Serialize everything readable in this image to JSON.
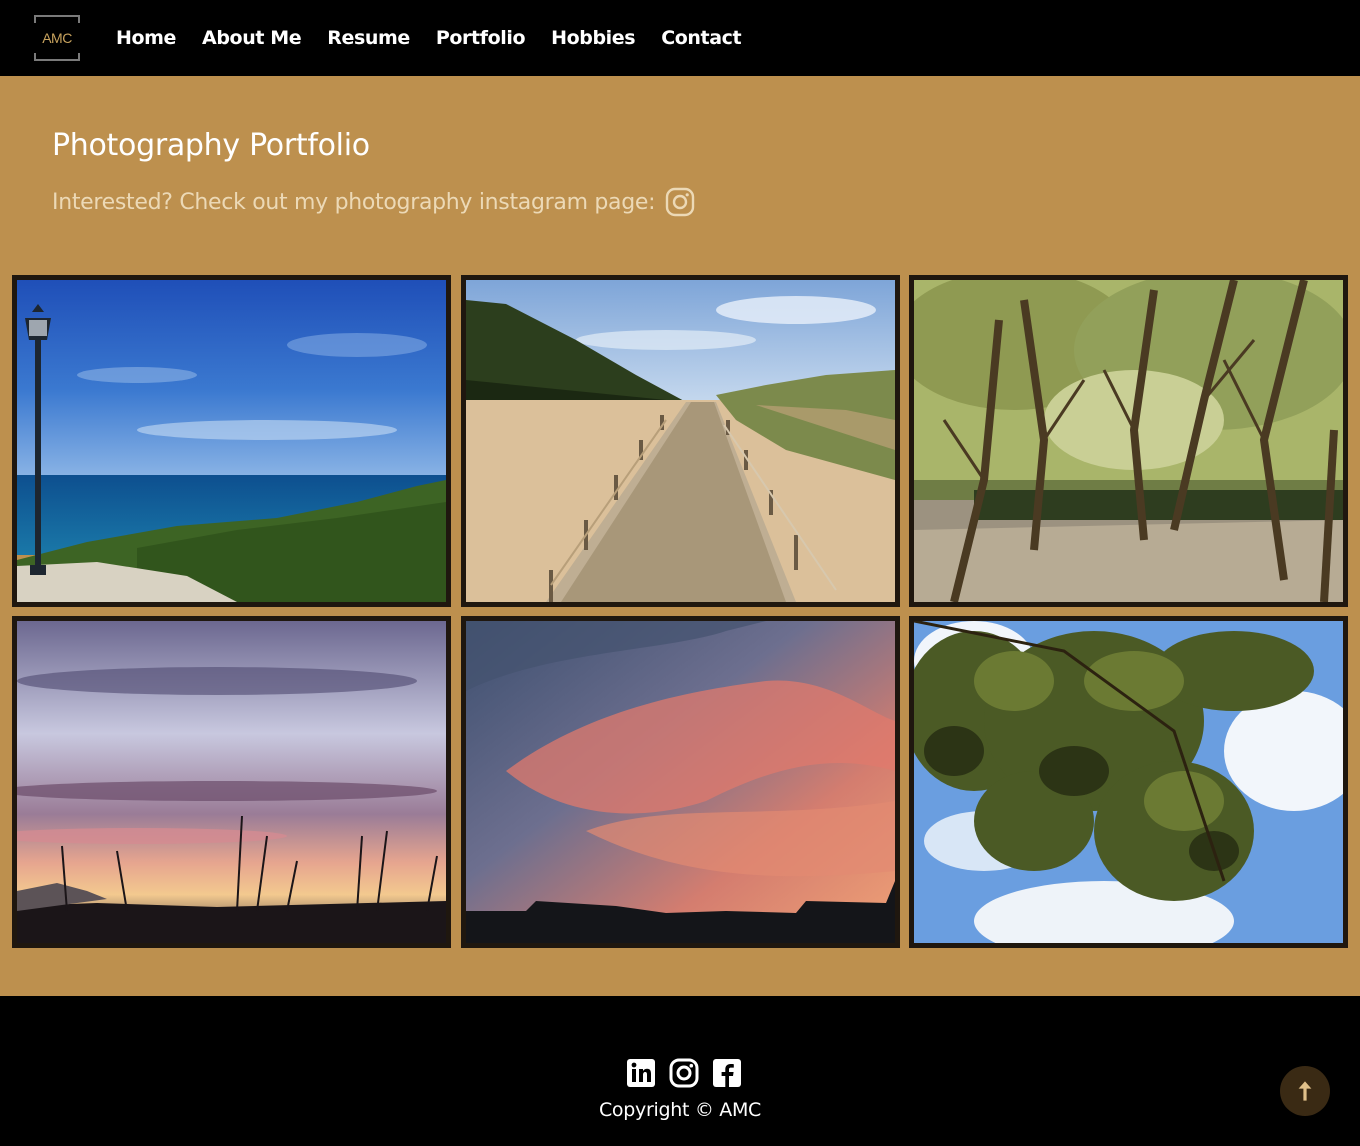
{
  "nav": {
    "logo_text": "AMC",
    "links": [
      {
        "label": "Home"
      },
      {
        "label": "About Me"
      },
      {
        "label": "Resume"
      },
      {
        "label": "Portfolio"
      },
      {
        "label": "Hobbies"
      },
      {
        "label": "Contact"
      }
    ]
  },
  "header": {
    "title": "Photography Portfolio",
    "subtitle": "Interested? Check out my photography instagram page:",
    "instagram_icon": "instagram-icon"
  },
  "gallery": {
    "photos": [
      {
        "subject": "sea-view-with-lamppost"
      },
      {
        "subject": "beach-boardwalk"
      },
      {
        "subject": "tree-lined-path"
      },
      {
        "subject": "sunset-with-grass"
      },
      {
        "subject": "pink-cloud-sky"
      },
      {
        "subject": "tree-leaves-blue-sky"
      }
    ]
  },
  "footer": {
    "social_icons": [
      "linkedin-icon",
      "instagram-icon",
      "facebook-icon"
    ],
    "copyright": "Copyright © AMC",
    "back_to_top_icon": "arrow-up-icon"
  },
  "colors": {
    "page_bg": "#bd904e",
    "nav_bg": "#000000",
    "footer_bg": "#000000",
    "photo_border": "#1f170f",
    "subtitle_text": "#ecd9b6",
    "back_to_top_bg": "#3a2a14"
  }
}
